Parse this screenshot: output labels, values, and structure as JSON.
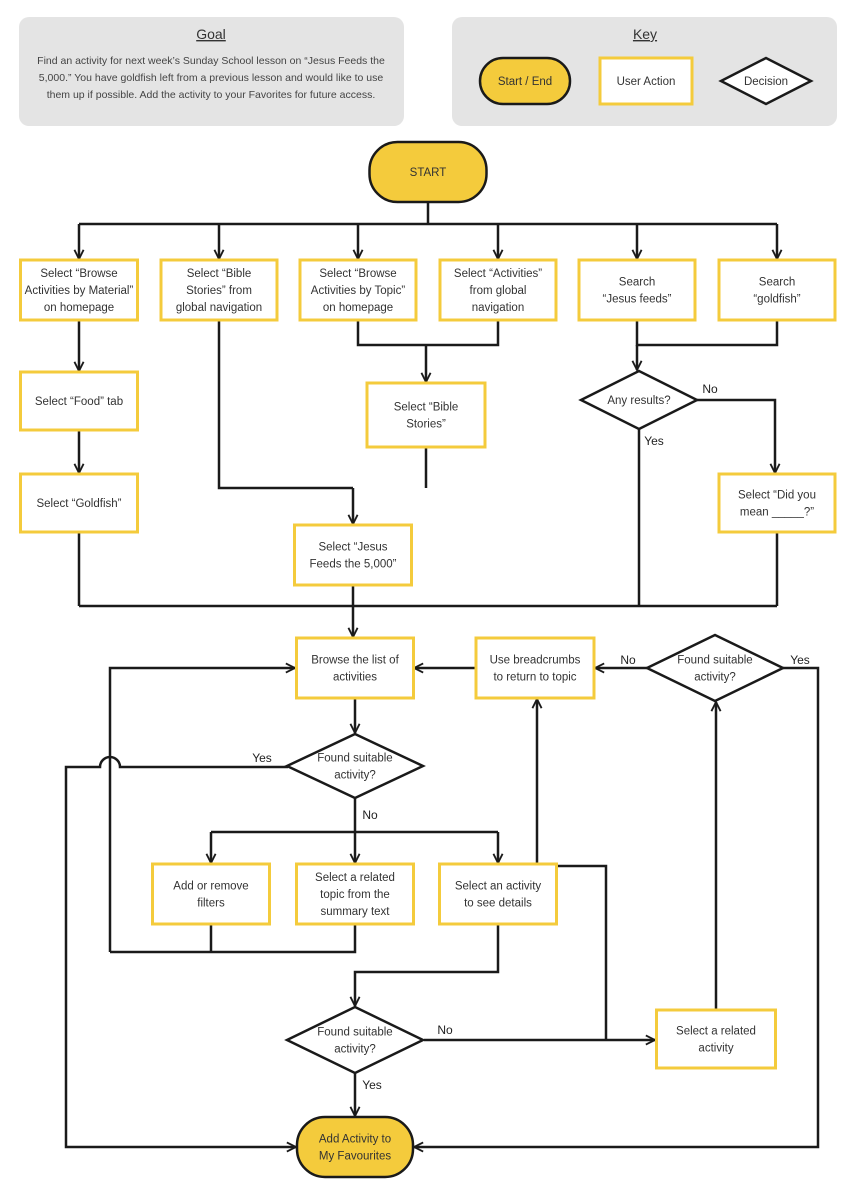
{
  "goal": {
    "title": "Goal",
    "lines": [
      "Find an activity for next week’s Sunday School lesson on “Jesus Feeds the",
      "5,000.”  You have goldfish left from a previous lesson and would like to use",
      "them up if possible.  Add the activity to your Favorites for future access."
    ]
  },
  "key": {
    "title": "Key",
    "start_end": "Start / End",
    "user_action": "User Action",
    "decision": "Decision"
  },
  "colors": {
    "accent": "#F4CB3C",
    "terminal_fill": "#F4CB3C",
    "panel": "#E4E4E4",
    "line": "#1A1A1A"
  },
  "nodes": {
    "start": {
      "type": "terminal",
      "lines": [
        "START"
      ]
    },
    "material": {
      "type": "action",
      "lines": [
        "Select “Browse",
        "Activities by Material”",
        "on homepage"
      ]
    },
    "bible_nav": {
      "type": "action",
      "lines": [
        "Select “Bible",
        "Stories” from",
        "global navigation"
      ]
    },
    "topic": {
      "type": "action",
      "lines": [
        "Select “Browse",
        "Activities by Topic”",
        "on homepage"
      ]
    },
    "activities_nav": {
      "type": "action",
      "lines": [
        "Select “Activities”",
        "from global",
        "navigation"
      ]
    },
    "search_jesus": {
      "type": "action",
      "lines": [
        "Search",
        "“Jesus feeds”"
      ]
    },
    "search_goldfish": {
      "type": "action",
      "lines": [
        "Search",
        "“goldfish”"
      ]
    },
    "food_tab": {
      "type": "action",
      "lines": [
        "Select “Food” tab"
      ]
    },
    "goldfish": {
      "type": "action",
      "lines": [
        "Select “Goldfish”"
      ]
    },
    "bible_stories": {
      "type": "action",
      "lines": [
        "Select “Bible",
        "Stories”"
      ]
    },
    "any_results": {
      "type": "decision",
      "lines": [
        "Any results?"
      ]
    },
    "did_you_mean": {
      "type": "action",
      "lines": [
        "Select “Did you",
        "mean _____?”"
      ]
    },
    "jesus_feeds": {
      "type": "action",
      "lines": [
        "Select “Jesus",
        "Feeds the 5,000”"
      ]
    },
    "browse_list": {
      "type": "action",
      "lines": [
        "Browse the list of",
        "activities"
      ]
    },
    "breadcrumbs": {
      "type": "action",
      "lines": [
        "Use breadcrumbs",
        "to return to topic"
      ]
    },
    "found_top": {
      "type": "decision",
      "lines": [
        "Found suitable",
        "activity?"
      ]
    },
    "found_mid": {
      "type": "decision",
      "lines": [
        "Found suitable",
        "activity?"
      ]
    },
    "filters": {
      "type": "action",
      "lines": [
        "Add or remove",
        "filters"
      ]
    },
    "related_topic": {
      "type": "action",
      "lines": [
        "Select a related",
        "topic from the",
        "summary text"
      ]
    },
    "activity_details": {
      "type": "action",
      "lines": [
        "Select an activity",
        "to see details"
      ]
    },
    "found_bottom": {
      "type": "decision",
      "lines": [
        "Found suitable",
        "activity?"
      ]
    },
    "related_activity": {
      "type": "action",
      "lines": [
        "Select a related",
        "activity"
      ]
    },
    "end": {
      "type": "terminal",
      "lines": [
        "Add Activity to",
        "My Favourites"
      ]
    }
  },
  "edge_labels": {
    "any_no": "No",
    "any_yes": "Yes",
    "top_no": "No",
    "top_yes": "Yes",
    "mid_yes": "Yes",
    "mid_no": "No",
    "bottom_no": "No",
    "bottom_yes": "Yes"
  }
}
